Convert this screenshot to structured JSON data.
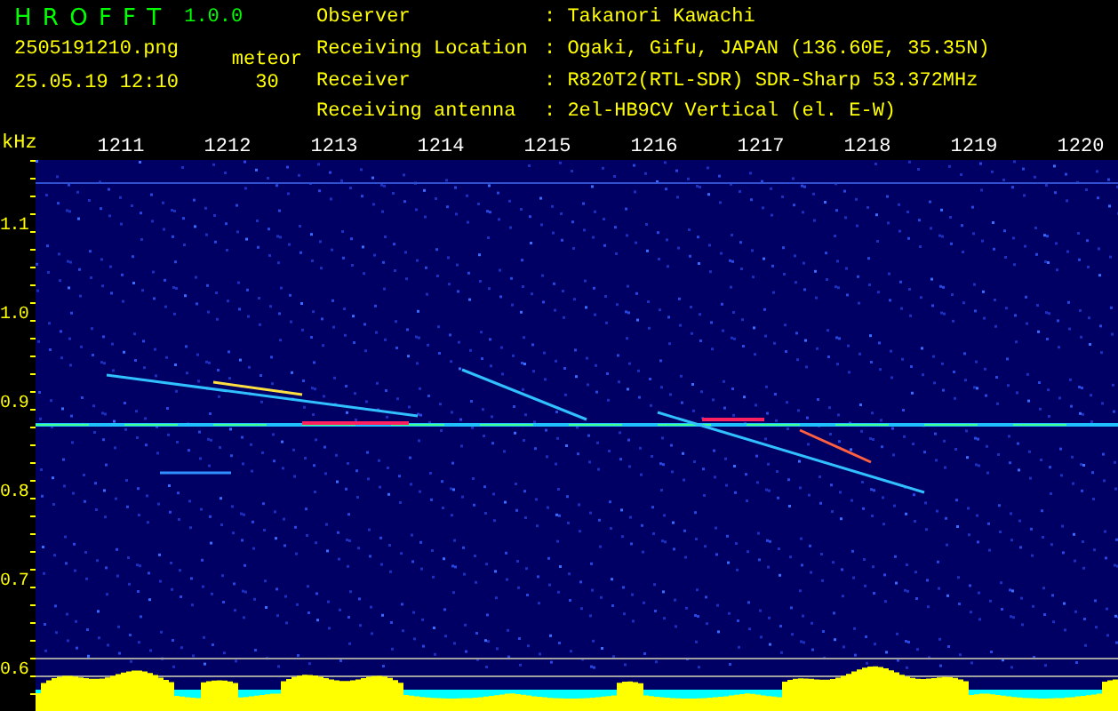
{
  "header": {
    "logo": "H R O F F T",
    "version": "1.0.0",
    "filename": "2505191210.png",
    "timestamp": "25.05.19 12:10",
    "count_label": "meteor",
    "count": "30"
  },
  "info": [
    {
      "label": "Observer",
      "value": ": Takanori Kawachi"
    },
    {
      "label": "Receiving Location",
      "value": ": Ogaki, Gifu, JAPAN (136.60E, 35.35N)"
    },
    {
      "label": "Receiver",
      "value": ": R820T2(RTL-SDR) SDR-Sharp 53.372MHz"
    },
    {
      "label": "Receiving antenna",
      "value": ": 2el-HB9CV Vertical (el. E-W)"
    }
  ],
  "axis": {
    "unit": "kHz",
    "x_ticks": [
      "1211",
      "1212",
      "1213",
      "1214",
      "1215",
      "1216",
      "1217",
      "1218",
      "1219",
      "1220"
    ],
    "y_ticks": [
      "1.1",
      "1.0",
      "0.9",
      "0.8",
      "0.7",
      "0.6"
    ]
  }
}
